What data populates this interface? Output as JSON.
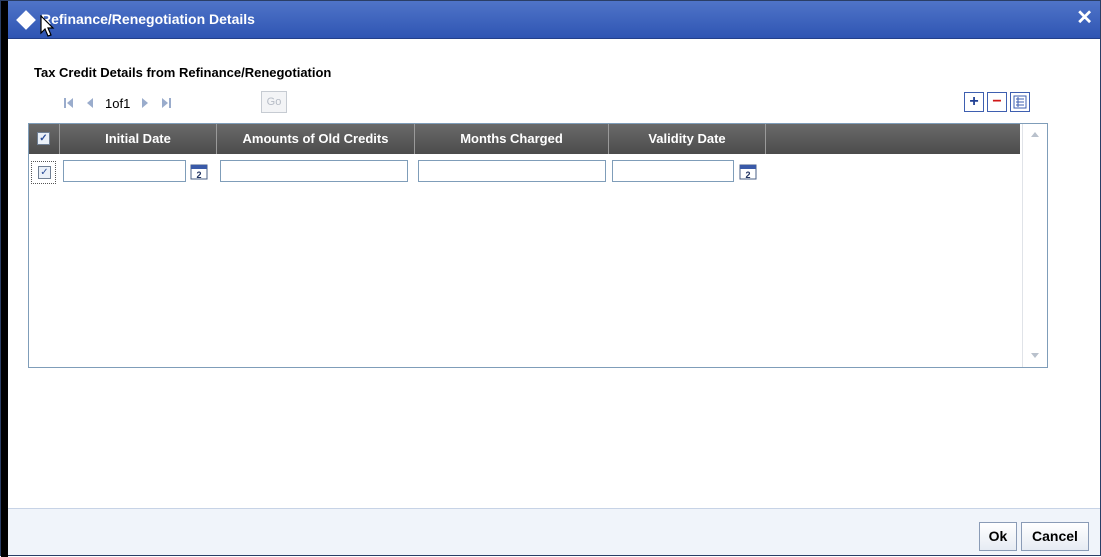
{
  "dialog": {
    "title": "Refinance/Renegotiation Details",
    "close_label": "✕"
  },
  "section": {
    "title": "Tax Credit Details from Refinance/Renegotiation"
  },
  "pager": {
    "page_text": "1of1",
    "go_label": "Go"
  },
  "table": {
    "columns": [
      "Initial Date",
      "Amounts of Old Credits",
      "Months Charged",
      "Validity Date"
    ],
    "rows": [
      {
        "checked": true,
        "initial_date": "",
        "amounts_of_old_credits": "",
        "months_charged": "",
        "validity_date": ""
      }
    ]
  },
  "toolbar": {
    "add_label": "+",
    "remove_label": "−",
    "view_icon": "list-view-icon"
  },
  "footer": {
    "ok_label": "Ok",
    "cancel_label": "Cancel"
  },
  "colors": {
    "titlebar": "#2f55b3",
    "header": "#555555",
    "accent": "#3e5fb0"
  }
}
